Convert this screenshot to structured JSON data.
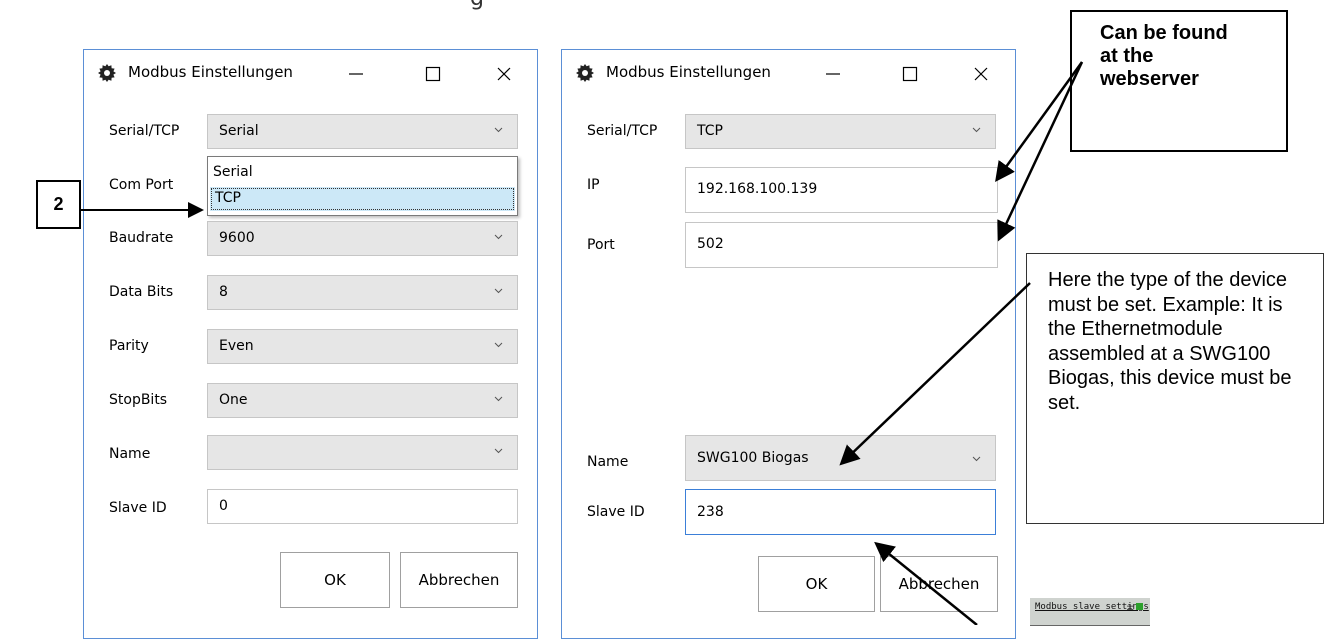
{
  "caption": "g",
  "dialog_left": {
    "title": "Modbus Einstellungen",
    "rows": [
      {
        "label": "Serial/TCP",
        "value": "Serial",
        "type": "combo"
      },
      {
        "label": "Com Port",
        "value": "",
        "type": "combo"
      },
      {
        "label": "Baudrate",
        "value": "9600",
        "type": "combo"
      },
      {
        "label": "Data Bits",
        "value": "8",
        "type": "combo"
      },
      {
        "label": "Parity",
        "value": "Even",
        "type": "combo"
      },
      {
        "label": "StopBits",
        "value": "One",
        "type": "combo"
      },
      {
        "label": "Name",
        "value": "",
        "type": "combo"
      },
      {
        "label": "Slave ID",
        "value": "0",
        "type": "text"
      }
    ],
    "dropdown_options": [
      "Serial",
      "TCP"
    ],
    "dropdown_selected": "TCP",
    "ok_label": "OK",
    "cancel_label": "Abbrechen"
  },
  "dialog_right": {
    "title": "Modbus Einstellungen",
    "rows": [
      {
        "label": "Serial/TCP",
        "value": "TCP",
        "type": "combo"
      },
      {
        "label": "IP",
        "value": "192.168.100.139",
        "type": "text"
      },
      {
        "label": "Port",
        "value": "502",
        "type": "text"
      },
      {
        "label": "Name",
        "value": "SWG100 Biogas",
        "type": "combo"
      },
      {
        "label": "Slave ID",
        "value": "238",
        "type": "text"
      }
    ],
    "ok_label": "OK",
    "cancel_label": "Abbrechen"
  },
  "callouts": {
    "step_number": "2",
    "webserver_line1": "Can be found",
    "webserver_line2": "at the",
    "webserver_line3": "webserver",
    "device_text": "Here the type of the device must be set. Example: It is the Ethernetmodule assembled at a SWG100 Biogas, this device must be set."
  },
  "mini_panel": {
    "title": "Modbus slave settings",
    "icons": "±",
    "status_color": "#2ca02c"
  },
  "colors": {
    "dialog_border": "#5b8fd6",
    "combo_bg": "#e6e6e6",
    "selection_bg": "#cce8f7",
    "focus_border": "#3b7fd8"
  }
}
